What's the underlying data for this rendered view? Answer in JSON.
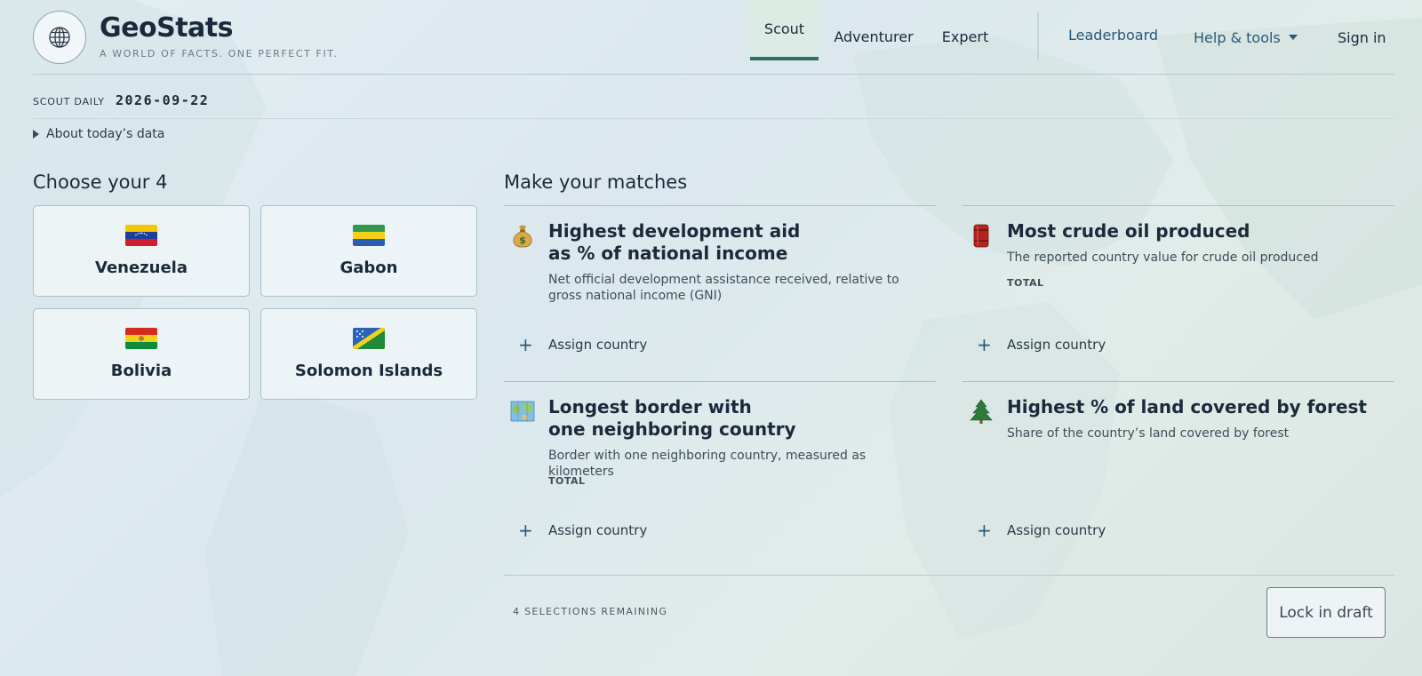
{
  "brand": {
    "name": "GeoStats",
    "tagline": "A WORLD OF FACTS. ONE PERFECT FIT."
  },
  "nav": {
    "tabs": [
      {
        "label": "Scout",
        "active": true
      },
      {
        "label": "Adventurer",
        "active": false
      },
      {
        "label": "Expert",
        "active": false
      }
    ],
    "leaderboard": "Leaderboard",
    "help": "Help & tools",
    "sign_in": "Sign in"
  },
  "daily": {
    "label": "SCOUT DAILY",
    "date": "2026-09-22",
    "about": "About today’s data"
  },
  "choose": {
    "heading": "Choose your 4",
    "countries": [
      {
        "name": "Venezuela",
        "flag": "venezuela-flag-icon"
      },
      {
        "name": "Gabon",
        "flag": "gabon-flag-icon"
      },
      {
        "name": "Bolivia",
        "flag": "bolivia-flag-icon"
      },
      {
        "name": "Solomon Islands",
        "flag": "solomon-islands-flag-icon"
      }
    ]
  },
  "matches": {
    "heading": "Make your matches",
    "items": [
      {
        "icon": "money-bag-icon",
        "title_line1": "Highest development aid",
        "title_line2": "as % of national income",
        "desc_line1": "Net official development assistance received, relative to",
        "desc_line2": "gross national income (GNI)",
        "tag": "",
        "assign": "Assign country"
      },
      {
        "icon": "oil-barrel-icon",
        "title_line1": "Most crude oil produced",
        "title_line2": "",
        "desc_line1": "The reported country value for crude oil produced",
        "desc_line2": "",
        "tag": "TOTAL",
        "assign": "Assign country"
      },
      {
        "icon": "map-icon",
        "title_line1": "Longest border with",
        "title_line2": "one neighboring country",
        "desc_line1": "Border with one neighboring country, measured as kilometers",
        "desc_line2": "",
        "tag": "TOTAL",
        "assign": "Assign country"
      },
      {
        "icon": "evergreen-tree-icon",
        "title_line1": "Highest % of land covered by forest",
        "title_line2": "",
        "desc_line1": "Share of the country’s land covered by forest",
        "desc_line2": "",
        "tag": "",
        "assign": "Assign country"
      }
    ]
  },
  "footer": {
    "remaining": "4 SELECTIONS REMAINING",
    "lock": "Lock in draft"
  },
  "colors": {
    "accent": "#2f6f66",
    "link": "#2a5878",
    "text": "#1b2a3a"
  }
}
